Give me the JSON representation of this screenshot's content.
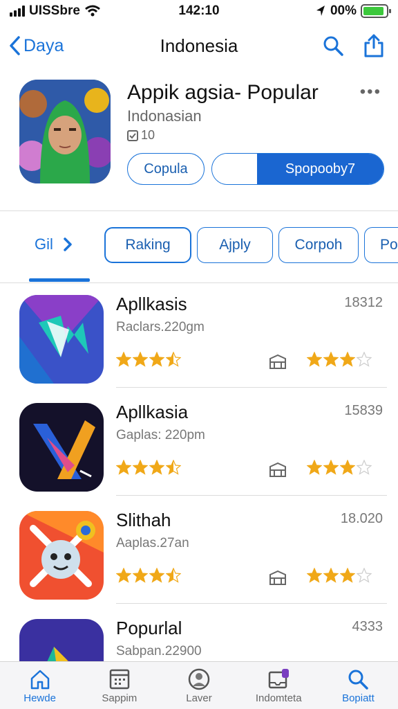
{
  "status_bar": {
    "carrier": "UISSbre",
    "time": "142:10",
    "battery_text": "00%",
    "battery_level": 0.9
  },
  "nav": {
    "back_label": "Daya",
    "title": "Indonesia"
  },
  "app": {
    "title": "Appik agsia-  Popular",
    "subtitle": "Indonasian",
    "age_rating": "10",
    "button_primary": "Copula",
    "button_secondary": "Spopooby7",
    "more_label": "•••"
  },
  "filters": {
    "lead_label": "Gil",
    "chips": [
      "Raking",
      "Ajply",
      "Corpoh",
      "Po"
    ]
  },
  "apps": [
    {
      "name": "Apllkasis",
      "meta": "Raclars.220gm",
      "count": "18312",
      "stars_left": 3.5,
      "stars_right": 3
    },
    {
      "name": "Apllkasia",
      "meta": "Gaplas: 220pm",
      "count": "15839",
      "stars_left": 3.5,
      "stars_right": 3
    },
    {
      "name": "Slithah",
      "meta": "Aaplas.27an",
      "count": "18.020",
      "stars_left": 3.5,
      "stars_right": 3
    },
    {
      "name": "Popurlal",
      "meta": "Sabpan.22900",
      "count": "4333",
      "stars_left": 0,
      "stars_right": 0
    }
  ],
  "tabs": [
    {
      "label": "Hewde",
      "icon": "home-icon",
      "active": true
    },
    {
      "label": "Sappim",
      "icon": "calendar-icon",
      "active": false
    },
    {
      "label": "Laver",
      "icon": "person-icon",
      "active": false
    },
    {
      "label": "Indomteta",
      "icon": "inbox-icon",
      "active": false
    },
    {
      "label": "Bopiatt",
      "icon": "search-icon",
      "active": true
    }
  ],
  "colors": {
    "accent": "#1a73d9",
    "star": "#f0a818",
    "star_empty": "#cccccc"
  }
}
